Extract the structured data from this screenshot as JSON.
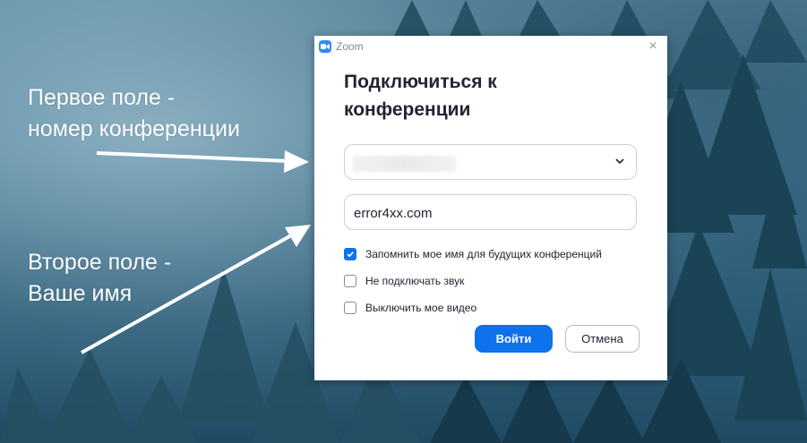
{
  "annotations": {
    "first_field": [
      "Первое поле -",
      "номер конференции"
    ],
    "second_field": [
      "Второе поле -",
      "Ваше имя"
    ]
  },
  "window": {
    "app_title": "Zoom",
    "close_glyph": "×"
  },
  "dialog": {
    "heading_lines": [
      "Подключиться к",
      "конференции"
    ],
    "meeting_id": {
      "value": "",
      "dropdown_icon": "chevron-down-icon"
    },
    "name_field": {
      "value": "error4xx.com"
    },
    "options": [
      {
        "label": "Запомнить мое имя для будущих конференций",
        "checked": true
      },
      {
        "label": "Не подключать звук",
        "checked": false
      },
      {
        "label": "Выключить мое видео",
        "checked": false
      }
    ],
    "join_label": "Войти",
    "cancel_label": "Отмена"
  },
  "colors": {
    "accent": "#0e72ed",
    "heading": "#232333"
  }
}
